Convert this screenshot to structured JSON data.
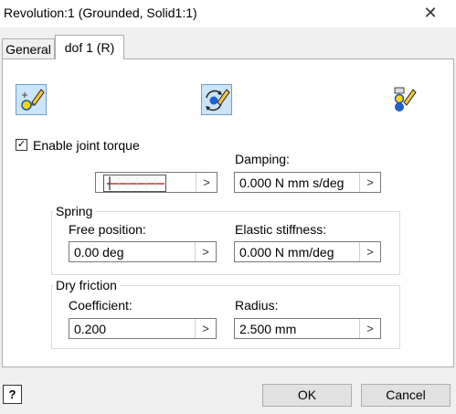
{
  "window": {
    "title": "Revolution:1 (Grounded, Solid1:1)",
    "close_glyph": "✕"
  },
  "tabs": [
    {
      "label": "General",
      "active": false
    },
    {
      "label": "dof 1 (R)",
      "active": true
    }
  ],
  "dof_mode_icons": [
    {
      "icon": "free-dof-icon",
      "selected": true
    },
    {
      "icon": "driven-dof-icon",
      "selected": true
    },
    {
      "icon": "locked-dof-icon",
      "selected": false
    }
  ],
  "joint_torque": {
    "label": "Enable joint torque",
    "checked": true,
    "check_glyph": "✓",
    "arrow": ">"
  },
  "damping": {
    "label": "Damping:",
    "value": "0.000 N mm s/deg",
    "arrow": ">"
  },
  "spring": {
    "title": "Spring",
    "free_position": {
      "label": "Free position:",
      "value": "0.00 deg",
      "arrow": ">"
    },
    "elastic_stiffness": {
      "label": "Elastic stiffness:",
      "value": "0.000 N mm/deg",
      "arrow": ">"
    }
  },
  "dry_friction": {
    "title": "Dry friction",
    "coefficient": {
      "label": "Coefficient:",
      "value": "0.200",
      "arrow": ">"
    },
    "radius": {
      "label": "Radius:",
      "value": "2.500 mm",
      "arrow": ">"
    }
  },
  "footer": {
    "help_glyph": "?",
    "ok_label": "OK",
    "cancel_label": "Cancel"
  },
  "colors": {
    "accent": "#0078d7",
    "selected_bg": "#cce4f7",
    "pencil": "#f4c542",
    "circle": "#ffd700"
  }
}
